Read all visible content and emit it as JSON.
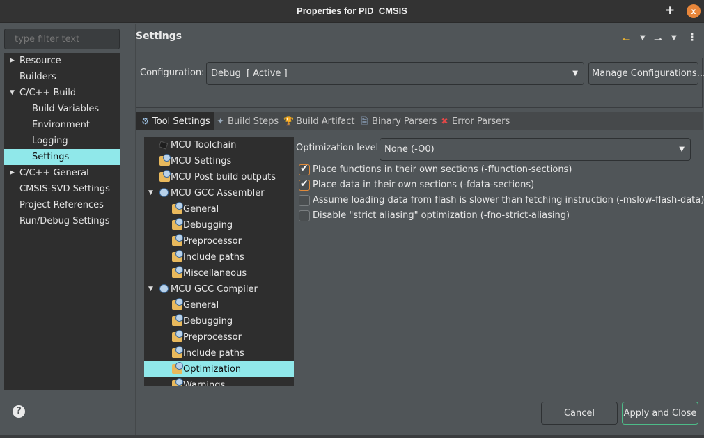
{
  "window": {
    "title": "Properties for PID_CMSIS",
    "plus_label": "+",
    "close_label": "x"
  },
  "sidebar": {
    "filter_placeholder": "type filter text",
    "items": [
      {
        "label": "Resource",
        "expander": "collapsed"
      },
      {
        "label": "Builders",
        "expander": "none"
      },
      {
        "label": "C/C++ Build",
        "expander": "expanded"
      },
      {
        "label": "Build Variables",
        "expander": "none"
      },
      {
        "label": "Environment",
        "expander": "none"
      },
      {
        "label": "Logging",
        "expander": "none"
      },
      {
        "label": "Settings",
        "expander": "none",
        "selected": true
      },
      {
        "label": "C/C++ General",
        "expander": "collapsed"
      },
      {
        "label": "CMSIS-SVD Settings",
        "expander": "none"
      },
      {
        "label": "Project References",
        "expander": "none"
      },
      {
        "label": "Run/Debug Settings",
        "expander": "none"
      }
    ]
  },
  "header": {
    "title": "Settings",
    "back_icon": "arrow-left-icon",
    "forward_icon": "arrow-right-icon",
    "menu_icon": "kebab-menu-icon"
  },
  "configuration": {
    "label": "Configuration:",
    "value": "Debug  [ Active ]",
    "manage_label": "Manage Configurations..."
  },
  "tabs": [
    {
      "label": "Tool Settings",
      "icon": "tool-settings-icon",
      "active": true
    },
    {
      "label": "Build Steps",
      "icon": "build-steps-icon"
    },
    {
      "label": "Build Artifact",
      "icon": "trophy-icon"
    },
    {
      "label": "Binary Parsers",
      "icon": "binary-file-icon"
    },
    {
      "label": "Error Parsers",
      "icon": "error-icon"
    }
  ],
  "tool_tree": [
    {
      "label": "MCU Toolchain",
      "icon": "chip-icon"
    },
    {
      "label": "MCU Settings",
      "icon": "folder-gear-icon"
    },
    {
      "label": "MCU Post build outputs",
      "icon": "folder-gear-icon"
    },
    {
      "label": "MCU GCC Assembler",
      "icon": "gear-icon",
      "expanded": true
    },
    {
      "label": "General",
      "icon": "folder-gear-icon"
    },
    {
      "label": "Debugging",
      "icon": "folder-gear-icon"
    },
    {
      "label": "Preprocessor",
      "icon": "folder-gear-icon"
    },
    {
      "label": "Include paths",
      "icon": "folder-gear-icon"
    },
    {
      "label": "Miscellaneous",
      "icon": "folder-gear-icon"
    },
    {
      "label": "MCU GCC Compiler",
      "icon": "gear-icon",
      "expanded": true
    },
    {
      "label": "General",
      "icon": "folder-gear-icon"
    },
    {
      "label": "Debugging",
      "icon": "folder-gear-icon"
    },
    {
      "label": "Preprocessor",
      "icon": "folder-gear-icon"
    },
    {
      "label": "Include paths",
      "icon": "folder-gear-icon"
    },
    {
      "label": "Optimization",
      "icon": "folder-gear-icon",
      "selected": true
    },
    {
      "label": "Warnings",
      "icon": "folder-gear-icon"
    }
  ],
  "optimization": {
    "level_label": "Optimization level",
    "level_value": "None (-O0)",
    "options": [
      {
        "label": "Place functions in their own sections (-ffunction-sections)",
        "checked": true
      },
      {
        "label": "Place data in their own sections (-fdata-sections)",
        "checked": true
      },
      {
        "label": "Assume loading data from flash is slower than fetching instruction (-mslow-flash-data)",
        "checked": false
      },
      {
        "label": "Disable \"strict aliasing\" optimization (-fno-strict-aliasing)",
        "checked": false
      }
    ]
  },
  "footer": {
    "help_label": "?",
    "cancel_label": "Cancel",
    "apply_label": "Apply and Close"
  },
  "colors": {
    "selection": "#90e8ea",
    "checkbox_accent": "#e08a3a",
    "default_button_border": "#4dbb88",
    "close_button": "#e8863a"
  }
}
